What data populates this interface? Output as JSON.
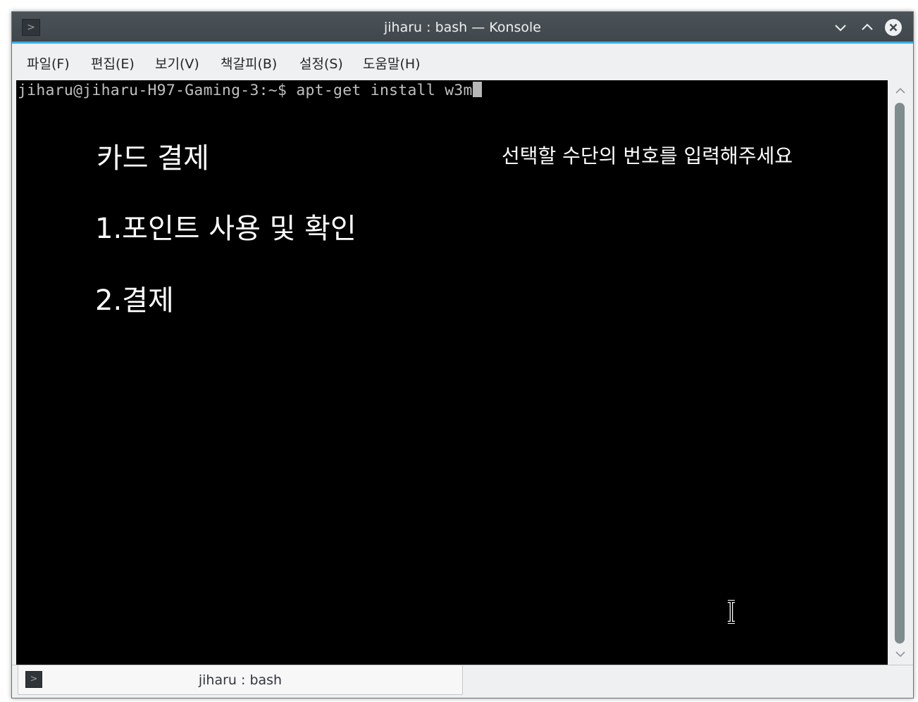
{
  "window": {
    "title": "jiharu : bash — Konsole"
  },
  "menubar": {
    "items": [
      {
        "label": "파일(F)"
      },
      {
        "label": "편집(E)"
      },
      {
        "label": "보기(V)"
      },
      {
        "label": "책갈피(B)"
      },
      {
        "label": "설정(S)"
      },
      {
        "label": "도움말(H)"
      }
    ]
  },
  "terminal": {
    "prompt": "jiharu@jiharu-H97-Gaming-3:~$ apt-get install w3m"
  },
  "overlay": {
    "title": "카드 결제",
    "option_1": "1.포인트 사용 및 확인",
    "option_2": "2.결제",
    "instruction": "선택할 수단의 번호를 입력해주세요"
  },
  "tabbar": {
    "tab_label": "jiharu : bash"
  },
  "icons": {
    "app": "terminal-icon",
    "minimize": "chevron-down-icon",
    "maximize": "chevron-up-icon",
    "close": "close-icon",
    "tab": "terminal-icon",
    "pointer": "text-cursor-icon"
  },
  "colors": {
    "accent": "#3daee9",
    "titlebar": "#475057",
    "terminal_bg": "#000000",
    "terminal_fg": "#c0c0c0"
  }
}
